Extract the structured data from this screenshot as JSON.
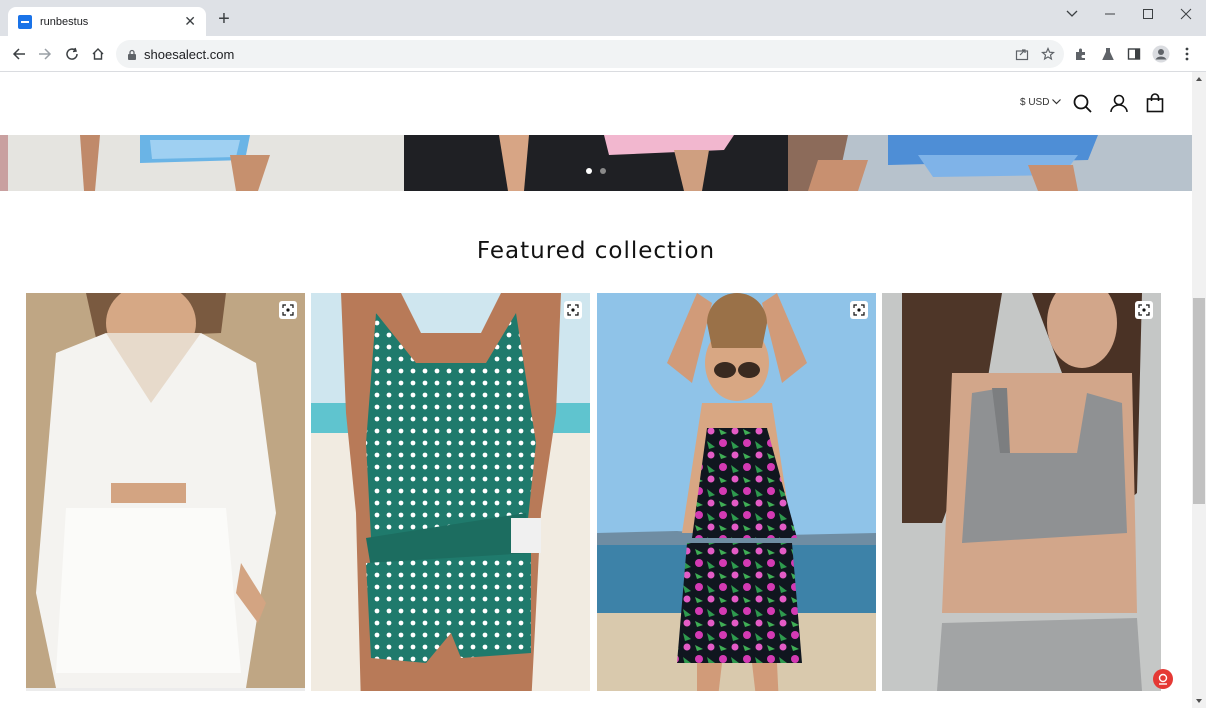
{
  "browser": {
    "tab_title": "runbestus",
    "url": "shoesalect.com",
    "window_controls": [
      "chevron-down-icon",
      "minimize-icon",
      "maximize-icon",
      "close-icon"
    ],
    "toolbar_icons": [
      "back-icon",
      "forward-icon",
      "reload-icon",
      "home-icon",
      "share-icon",
      "bookmark-star-icon",
      "extensions-icon",
      "labs-icon",
      "sidepanel-icon",
      "profile-icon",
      "menu-icon"
    ]
  },
  "header": {
    "currency": "$ USD",
    "icons": [
      "search-icon",
      "account-icon",
      "cart-icon"
    ]
  },
  "banner": {
    "active_slide": 1,
    "slide_count": 2
  },
  "featured": {
    "title": "Featured collection",
    "products": [
      {
        "name": "white-linen-set"
      },
      {
        "name": "green-polka-dot-tankini"
      },
      {
        "name": "floral-tankini-skirt"
      },
      {
        "name": "grey-knit-crop-top"
      }
    ]
  },
  "colors": {
    "chrome_bg": "#dee1e6",
    "omnibox_bg": "#f1f3f4",
    "chat_button": "#e53935"
  }
}
